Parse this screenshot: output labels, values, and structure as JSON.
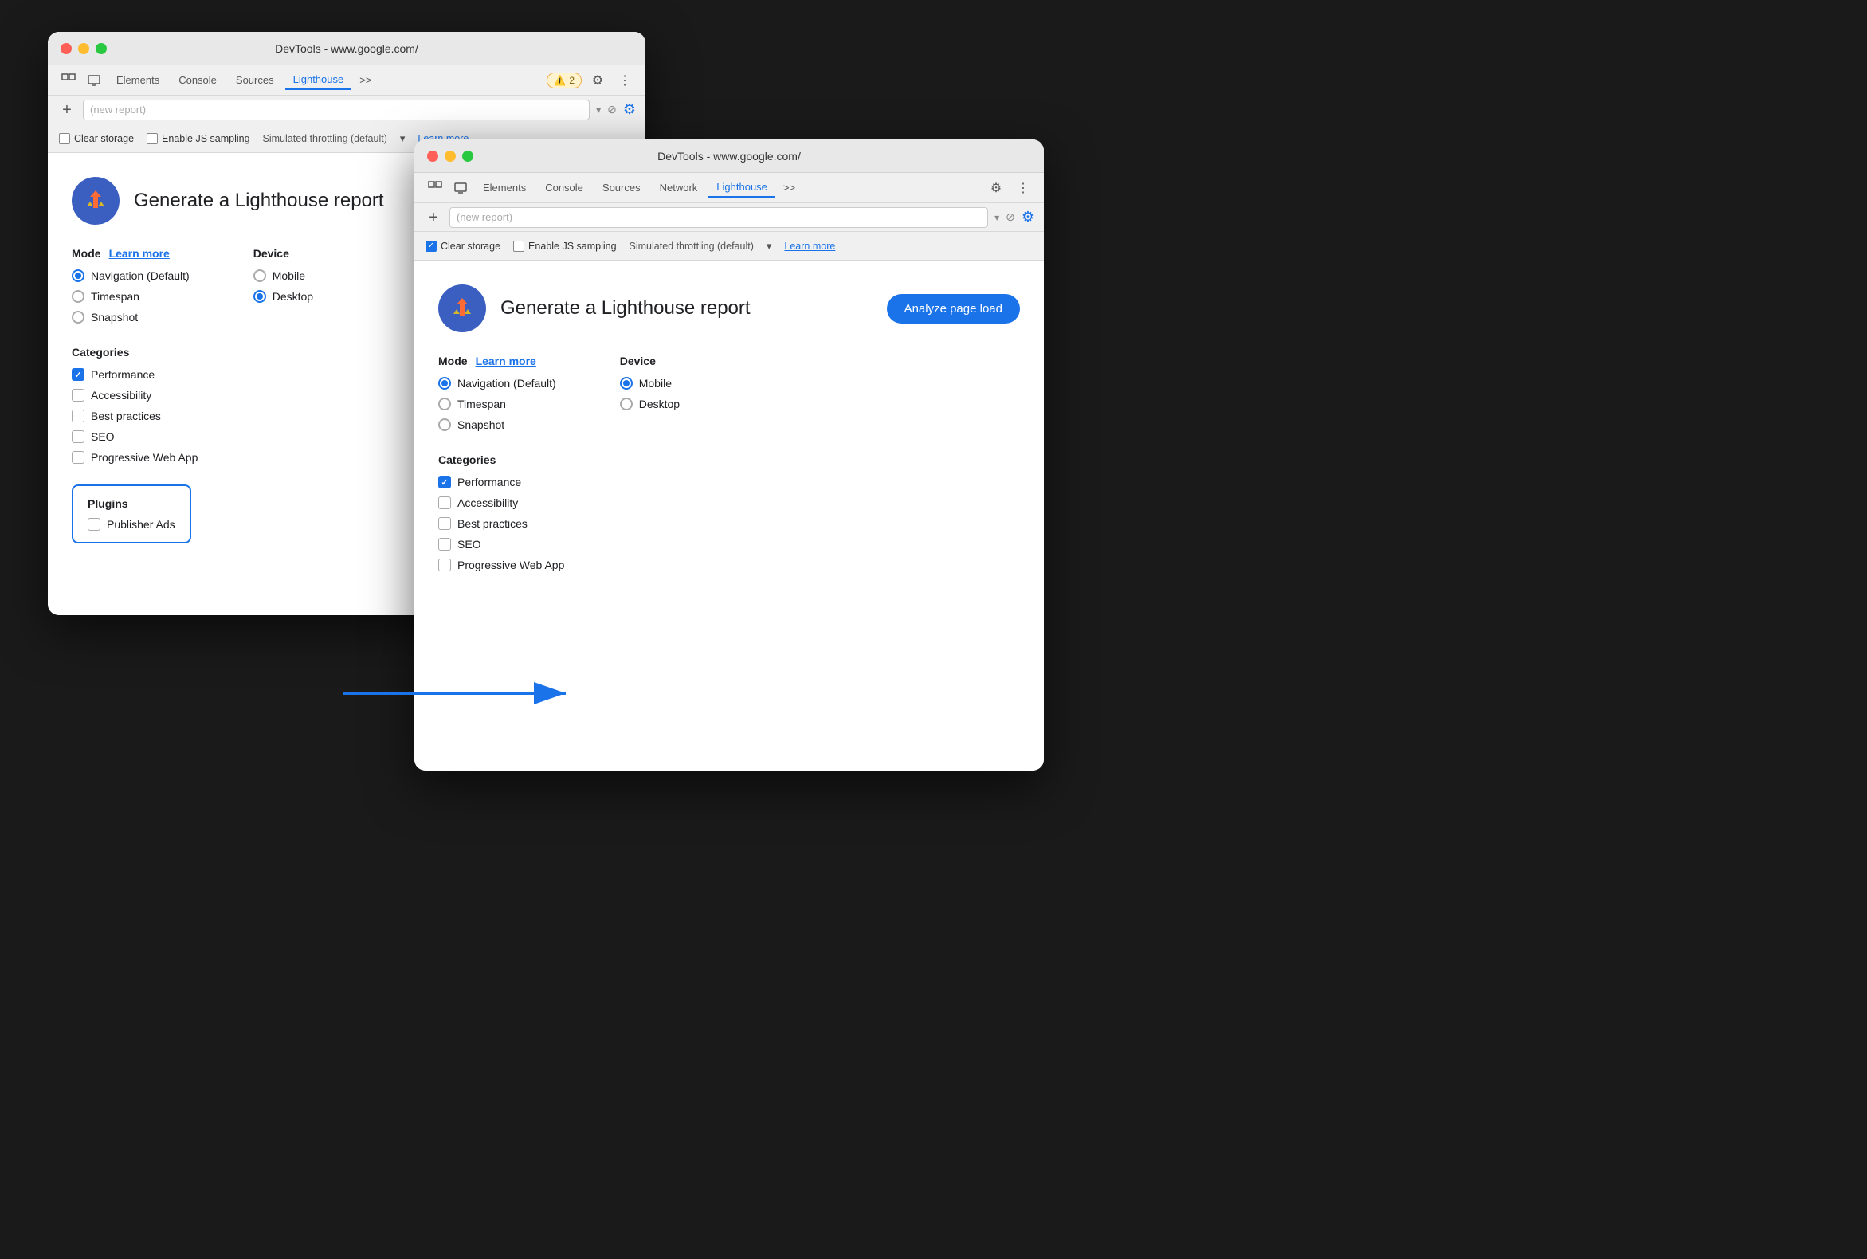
{
  "window1": {
    "title": "DevTools - www.google.com/",
    "tabs": [
      "Elements",
      "Console",
      "Sources",
      "Lighthouse",
      ">>"
    ],
    "active_tab": "Lighthouse",
    "address": "(new report)",
    "options": {
      "clear_storage": false,
      "enable_js_sampling": false,
      "throttling": "Simulated throttling (default)",
      "learn_more": "Learn more"
    },
    "report_title": "Generate a Lighthouse report",
    "mode_label": "Mode",
    "learn_more": "Learn more",
    "device_label": "Device",
    "modes": [
      {
        "label": "Navigation (Default)",
        "selected": true
      },
      {
        "label": "Timespan",
        "selected": false
      },
      {
        "label": "Snapshot",
        "selected": false
      }
    ],
    "devices": [
      {
        "label": "Mobile",
        "selected": false
      },
      {
        "label": "Desktop",
        "selected": true
      }
    ],
    "categories_label": "Categories",
    "categories": [
      {
        "label": "Performance",
        "checked": true
      },
      {
        "label": "Accessibility",
        "checked": false
      },
      {
        "label": "Best practices",
        "checked": false
      },
      {
        "label": "SEO",
        "checked": false
      },
      {
        "label": "Progressive Web App",
        "checked": false
      }
    ],
    "plugins_label": "Plugins",
    "plugins": [
      {
        "label": "Publisher Ads",
        "checked": false
      }
    ]
  },
  "window2": {
    "title": "DevTools - www.google.com/",
    "tabs": [
      "Elements",
      "Console",
      "Sources",
      "Network",
      "Lighthouse",
      ">>"
    ],
    "active_tab": "Lighthouse",
    "address": "(new report)",
    "options": {
      "clear_storage": true,
      "enable_js_sampling": false,
      "throttling": "Simulated throttling (default)",
      "learn_more": "Learn more"
    },
    "report_title": "Generate a Lighthouse report",
    "analyze_btn": "Analyze page load",
    "mode_label": "Mode",
    "learn_more": "Learn more",
    "device_label": "Device",
    "modes": [
      {
        "label": "Navigation (Default)",
        "selected": true
      },
      {
        "label": "Timespan",
        "selected": false
      },
      {
        "label": "Snapshot",
        "selected": false
      }
    ],
    "devices": [
      {
        "label": "Mobile",
        "selected": true
      },
      {
        "label": "Desktop",
        "selected": false
      }
    ],
    "categories_label": "Categories",
    "categories": [
      {
        "label": "Performance",
        "checked": true
      },
      {
        "label": "Accessibility",
        "checked": false
      },
      {
        "label": "Best practices",
        "checked": false
      },
      {
        "label": "SEO",
        "checked": false
      },
      {
        "label": "Progressive Web App",
        "checked": false
      }
    ]
  },
  "icons": {
    "inspector": "⬚",
    "device": "⬛",
    "settings": "⚙",
    "more": "⋮",
    "add": "+",
    "cancel": "⊘",
    "warning": "⚠",
    "warning_count": "2",
    "dropdown": "▾",
    "caret": "▾"
  }
}
